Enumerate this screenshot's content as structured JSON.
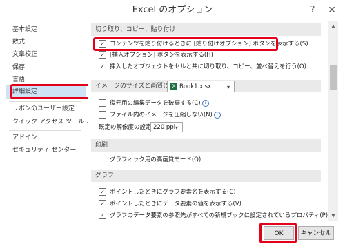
{
  "window": {
    "title": "Excel のオプション",
    "help_icon": "?",
    "close_icon": "✕"
  },
  "sidebar": {
    "items": [
      {
        "label": "基本設定"
      },
      {
        "label": "数式"
      },
      {
        "label": "文章校正"
      },
      {
        "label": "保存"
      },
      {
        "label": "言語"
      },
      {
        "label": "詳細設定",
        "selected": true
      },
      {
        "label": "リボンのユーザー設定"
      },
      {
        "label": "クイック アクセス ツール バー"
      },
      {
        "label": "アドイン"
      },
      {
        "label": "セキュリティ センター"
      }
    ]
  },
  "sections": {
    "cut_copy_paste": {
      "header": "切り取り、コピー、貼り付け",
      "options": [
        {
          "label": "コンテンツを貼り付けるときに [貼り付けオプション] ボタンを表示する(S)",
          "checked": true
        },
        {
          "label": "[挿入オプション] ボタンを表示する(H)",
          "checked": true
        },
        {
          "label": "挿入したオブジェクトをセルと共に切り取り、コピー、並べ替えを行う(O)",
          "checked": true
        }
      ]
    },
    "image_size": {
      "header": "イメージのサイズと画質(S)",
      "workbook": "Book1.xlsx",
      "excel_icon": "X",
      "options": [
        {
          "label": "復元用の編集データを破棄する(C)",
          "checked": false
        },
        {
          "label": "ファイル内のイメージを圧縮しない(N)",
          "checked": false
        }
      ],
      "resolution_label": "既定の解像度の設定(P):",
      "resolution_value": "220 ppi"
    },
    "print": {
      "header": "印刷",
      "options": [
        {
          "label": "グラフィック用の高画質モード(Q)",
          "checked": false
        }
      ]
    },
    "graph": {
      "header": "グラフ",
      "options": [
        {
          "label": "ポイントしたときにグラフ要素名を表示する(C)",
          "checked": true
        },
        {
          "label": "ポイントしたときにデータ要素の値を表示する(V)",
          "checked": true
        },
        {
          "label": "グラフのデータ要素の参照先がすべての新規ブックに設定されているプロパティ(P)",
          "checked": true
        }
      ]
    }
  },
  "footer": {
    "ok_label": "OK",
    "cancel_label": "キャンセル"
  },
  "icons": {
    "check": "✓",
    "dropdown": "▾",
    "info": "i",
    "scroll_up": "▲",
    "scroll_down": "▼"
  },
  "colors": {
    "highlight": "#e3001b",
    "selected_sidebar": "#cfe3f6",
    "excel_green": "#1e7145"
  }
}
